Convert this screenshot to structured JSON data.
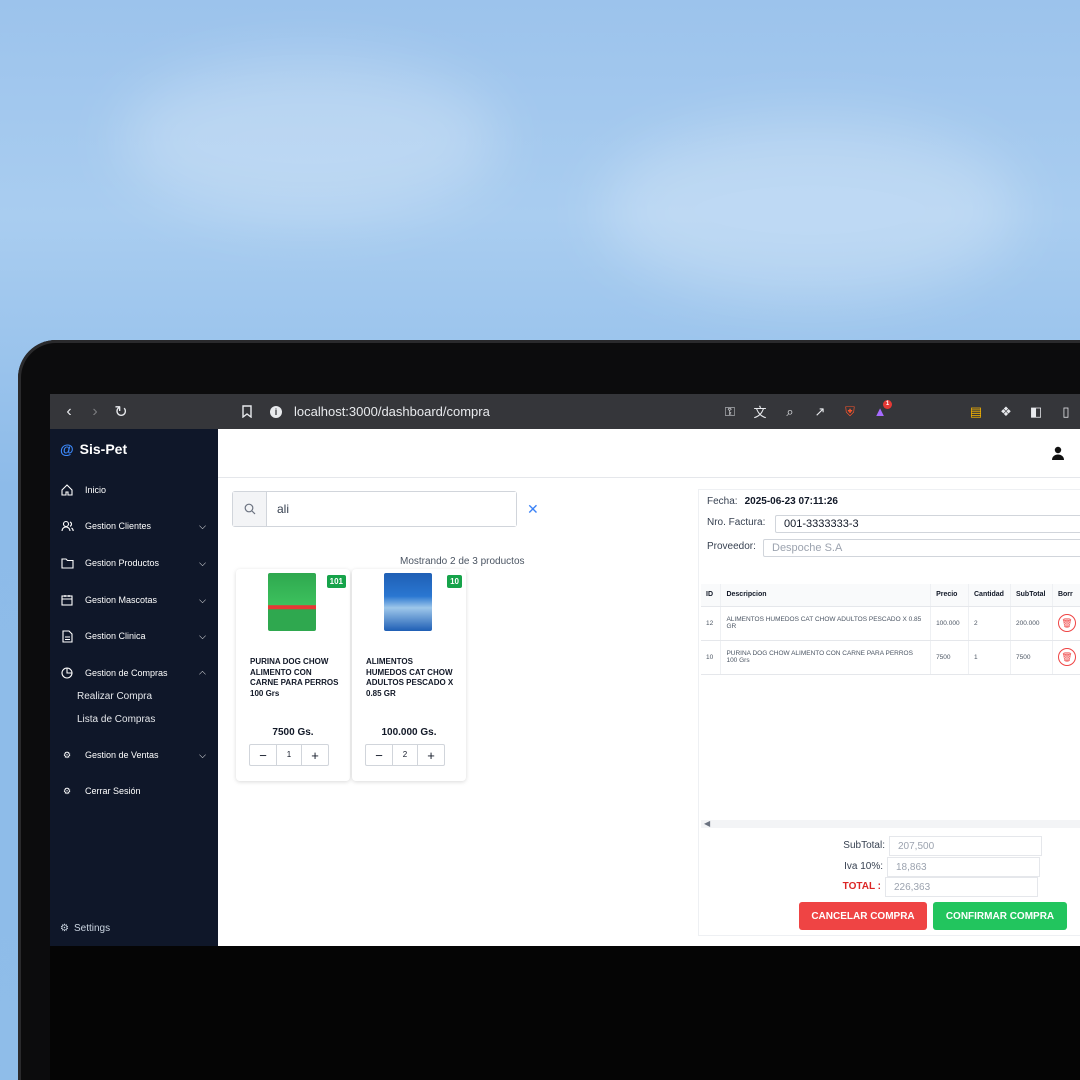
{
  "browser": {
    "url": "localhost:3000/dashboard/compra",
    "brave_badge": "1"
  },
  "sidebar": {
    "brand": "Sis-Pet",
    "items": [
      {
        "label": "Inicio",
        "icon": "home-icon"
      },
      {
        "label": "Gestion Clientes",
        "icon": "users-icon"
      },
      {
        "label": "Gestion Productos",
        "icon": "folder-icon"
      },
      {
        "label": "Gestion Mascotas",
        "icon": "calendar-icon"
      },
      {
        "label": "Gestion Clinica",
        "icon": "file-icon"
      },
      {
        "label": "Gestion de Compras",
        "icon": "pie-chart-icon"
      },
      {
        "label": "Gestion de Ventas",
        "icon": "gear-icon"
      },
      {
        "label": "Cerrar Sesión",
        "icon": "gear-icon"
      }
    ],
    "sub_items": [
      "Realizar Compra",
      "Lista de Compras"
    ],
    "settings": "Settings"
  },
  "search": {
    "value": "ali",
    "showing": "Mostrando 2 de 3 productos"
  },
  "products": [
    {
      "name": "PURINA DOG CHOW ALIMENTO CON CARNE PARA PERROS 100 Grs",
      "price": "7500 Gs.",
      "stock": "101",
      "qty": "1",
      "color": "#2fa84f"
    },
    {
      "name": "ALIMENTOS HUMEDOS CAT CHOW ADULTOS PESCADO X 0.85 GR",
      "price": "100.000 Gs.",
      "stock": "10",
      "qty": "2",
      "color": "#1f5fb5"
    }
  ],
  "invoice": {
    "fecha_label": "Fecha:",
    "fecha": "2025-06-23 07:11:26",
    "factura_label": "Nro. Factura:",
    "factura": "001-3333333-3",
    "proveedor_label": "Proveedor:",
    "proveedor": "Despoche S.A"
  },
  "table": {
    "headers": [
      "ID",
      "Descripcion",
      "Precio",
      "Cantidad",
      "SubTotal",
      "Borr"
    ],
    "rows": [
      {
        "id": "12",
        "desc": "ALIMENTOS HUMEDOS CAT CHOW ADULTOS PESCADO X 0.85 GR",
        "precio": "100.000",
        "cantidad": "2",
        "subtotal": "200.000"
      },
      {
        "id": "10",
        "desc": "PURINA DOG CHOW ALIMENTO CON CARNE PARA PERROS 100 Grs",
        "precio": "7500",
        "cantidad": "1",
        "subtotal": "7500"
      }
    ]
  },
  "totals": {
    "subtotal_label": "SubTotal:",
    "subtotal": "207,500",
    "iva_label": "Iva 10%:",
    "iva": "18,863",
    "total_label": "TOTAL :",
    "total": "226,363"
  },
  "actions": {
    "cancel": "CANCELAR COMPRA",
    "confirm": "CONFIRMAR COMPRA",
    "cancel_color": "#ef4444",
    "confirm_color": "#22c55e"
  }
}
